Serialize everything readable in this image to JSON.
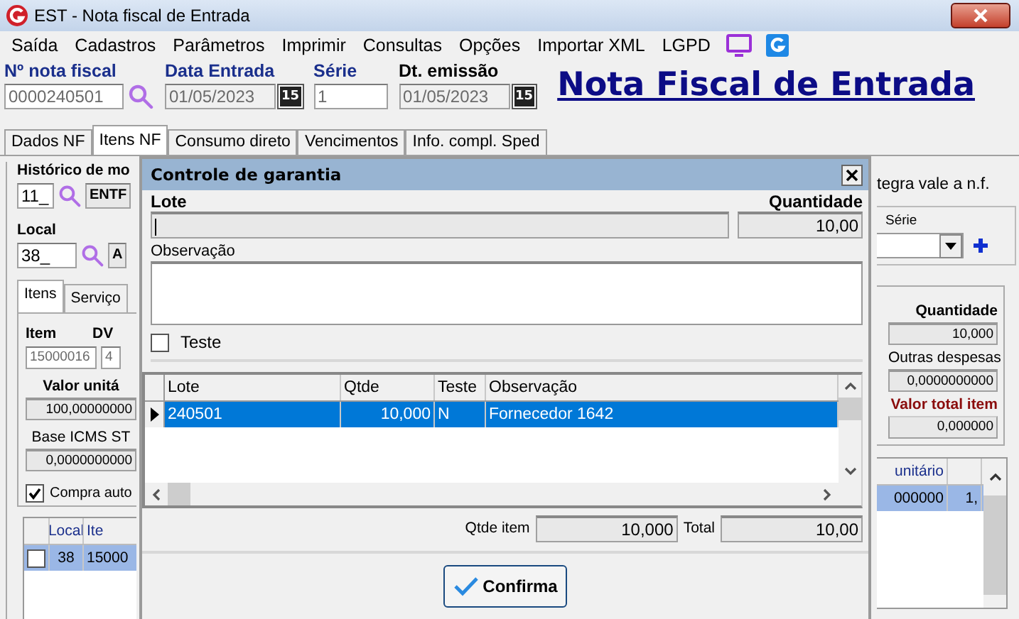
{
  "window": {
    "title": "EST - Nota fiscal de Entrada"
  },
  "menu": [
    {
      "label": "Saída"
    },
    {
      "label": "Cadastros"
    },
    {
      "label": "Parâmetros"
    },
    {
      "label": "Imprimir"
    },
    {
      "label": "Consultas"
    },
    {
      "label": "Opções"
    },
    {
      "label": "Importar XML"
    },
    {
      "label": "LGPD"
    }
  ],
  "header": {
    "fields": [
      {
        "label": "Nº nota fiscal",
        "value": "0000240501",
        "kind": "search",
        "required": true
      },
      {
        "label": "Data Entrada",
        "value": "01/05/2023",
        "kind": "date",
        "required": true,
        "icon_text": "15"
      },
      {
        "label": "Série",
        "value": "1",
        "kind": "plain",
        "required": true
      },
      {
        "label": "Dt. emissão",
        "value": "01/05/2023",
        "kind": "date",
        "required": false,
        "icon_text": "15"
      }
    ],
    "heading": "Nota Fiscal de Entrada"
  },
  "tabs": [
    {
      "label": "Dados NF",
      "selected": false
    },
    {
      "label": "Itens NF",
      "selected": true
    },
    {
      "label": "Consumo direto",
      "selected": false
    },
    {
      "label": "Vencimentos",
      "selected": false
    },
    {
      "label": "Info. compl. Sped",
      "selected": false
    }
  ],
  "left_panel": {
    "historico_label": "Histórico de mo",
    "historico_code": "11_",
    "historico_desc": "ENTF",
    "local_label": "Local",
    "local_code": "38_",
    "local_desc": "A",
    "subtabs": [
      {
        "label": "Itens",
        "selected": true
      },
      {
        "label": "Serviço",
        "selected": false
      }
    ],
    "item_label": "Item",
    "dv_label": "DV",
    "item": "15000016",
    "dv": "4",
    "valor_label": "Valor unitá",
    "valor": "100,00000000",
    "base_label": "Base ICMS ST",
    "base": "0,0000000000",
    "compra": {
      "label": "Compra auto",
      "checked": true
    },
    "grid": {
      "columns": [
        "Local",
        "Ite"
      ],
      "rows": [
        {
          "checked": false,
          "cells": [
            "38",
            "15000"
          ]
        }
      ]
    }
  },
  "right_panel": {
    "note": "tegra vale a n.f.",
    "serie_label": "Série",
    "quantidade_label": "Quantidade",
    "quantidade": "10,000",
    "outras_label": "Outras despesas",
    "outras": "0,0000000000",
    "total_label": "Valor total item",
    "total": "0,000000",
    "grid": {
      "columns": [
        "unitário"
      ],
      "rows": [
        {
          "cells": [
            "000000",
            "1,"
          ]
        }
      ]
    }
  },
  "dialog": {
    "title": "Controle de garantia",
    "lote_label": "Lote",
    "quantidade_label": "Quantidade",
    "quantidade": "10,00",
    "observacao_label": "Observação",
    "teste": {
      "label": "Teste",
      "checked": false
    },
    "grid": {
      "columns": [
        "Lote",
        "Qtde",
        "Teste",
        "Observação"
      ],
      "rows": [
        {
          "selected": true,
          "cells": [
            "240501",
            "10,000",
            "N",
            "Fornecedor 1642"
          ]
        }
      ]
    },
    "qtde_item_label": "Qtde item",
    "qtde_item": "10,000",
    "total_label": "Total",
    "total": "10,00",
    "confirm": "Confirma"
  }
}
